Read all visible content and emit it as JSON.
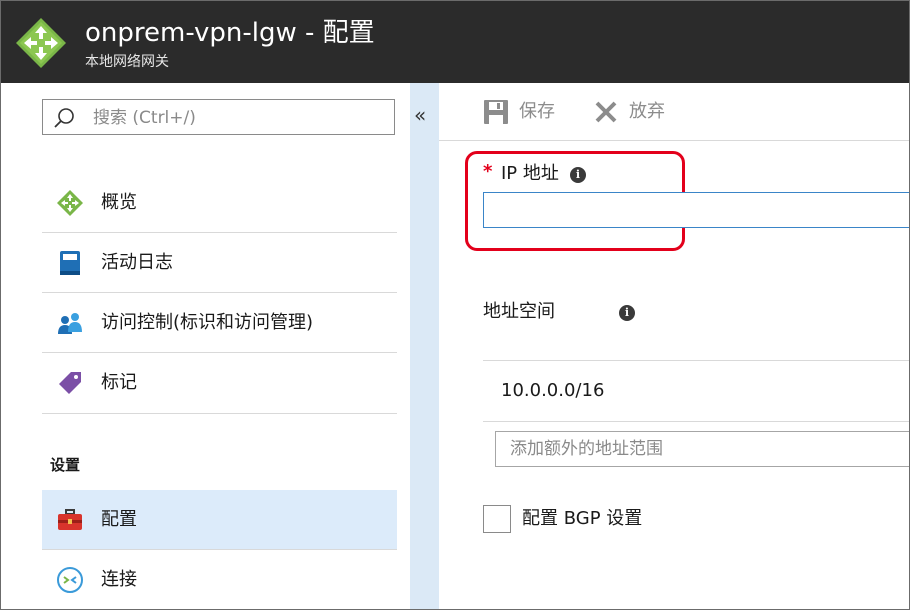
{
  "header": {
    "title": "onprem-vpn-lgw - 配置",
    "subtitle": "本地网络网关",
    "logo_icon": "local-network-gateway-icon"
  },
  "sidebar": {
    "search_placeholder": "搜索 (Ctrl+/)",
    "items": [
      {
        "label": "概览",
        "icon": "overview-gateway-icon"
      },
      {
        "label": "活动日志",
        "icon": "activity-log-icon"
      },
      {
        "label": "访问控制(标识和访问管理)",
        "icon": "access-control-icon"
      },
      {
        "label": "标记",
        "icon": "tag-icon"
      }
    ],
    "section_label": "设置",
    "settings_items": [
      {
        "label": "配置",
        "icon": "configuration-toolbox-icon",
        "active": true
      },
      {
        "label": "连接",
        "icon": "connections-icon"
      }
    ],
    "collapse_glyph": "«"
  },
  "toolbar": {
    "save_label": "保存",
    "discard_label": "放弃"
  },
  "form": {
    "ip_required_marker": "*",
    "ip_label": "IP 地址",
    "ip_value": "",
    "address_space_label": "地址空间",
    "address_space_values": [
      "10.0.0.0/16"
    ],
    "add_range_placeholder": "添加额外的地址范围",
    "bgp_label": "配置 BGP 设置",
    "bgp_checked": false,
    "info_glyph": "i"
  },
  "colors": {
    "header_bg": "#2b2b2b",
    "active_item_bg": "#dcebfa",
    "highlight_border": "#e3001b",
    "input_focus_border": "#3a85c8"
  }
}
